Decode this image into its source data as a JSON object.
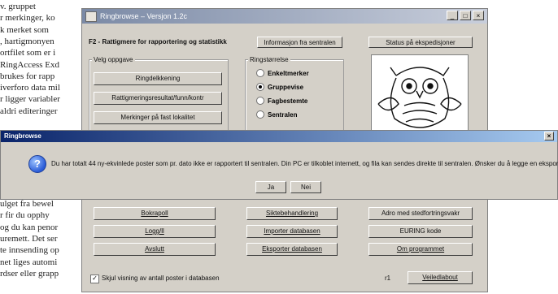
{
  "background_doc": {
    "lines": [
      "v. gruppet",
      "r merkinger, ko",
      "k merket som ",
      ", hartigmonyen",
      "ortfilet som er i",
      "RingAccess Exd",
      "brukes for rapp",
      "iverforo data mil",
      "r ligger variabler",
      "aldri editeringer",
      "",
      "",
      "",
      "",
      "",
      "",
      "",
      "ulget fra bewel",
      "r fir du opphy",
      "og du kan penor",
      "uremett. Det ser",
      "te innsending op",
      "net liges automi",
      "rdser eller grapp"
    ]
  },
  "main_window": {
    "title": "Ringbrowse – Versjon 1.2c",
    "buttons_window": [
      "_",
      "□",
      "×"
    ],
    "heading": "F2 - Rattigmere for rapportering og statistikk",
    "top_buttons": {
      "center": "Informasjon fra sentralen",
      "right": "Status på ekspedisjoner"
    },
    "left_group": {
      "label": "Velg oppgave",
      "buttons": [
        "Ringdelkkening",
        "Rattigmeringsresultat/funn/kontr",
        "Merkinger på fast lokalitet"
      ]
    },
    "mid_group": {
      "label": "Ringstørrelse",
      "radios": [
        {
          "label": "Enkeltmerker",
          "selected": false
        },
        {
          "label": "Gruppevise",
          "selected": true
        },
        {
          "label": "Fagbestemte",
          "selected": false
        },
        {
          "label": "Sentralen",
          "selected": false
        }
      ]
    },
    "bottom_buttons": {
      "col1": [
        "Bokrapoll",
        "Logg/ll",
        "Avslutt"
      ],
      "col2": [
        "Siktebehandlering",
        "Importer databasen",
        "Eksporter databasen"
      ],
      "col3": [
        "Adro med stedfortringsvakr",
        "EURING kode",
        "Om programmet"
      ]
    },
    "footer_checkbox_label": "Skjul visning av antall poster i databasen",
    "footer_checkbox_checked": true,
    "footer_small": "r1",
    "footer_button": "Veiledlabout"
  },
  "dialog": {
    "title": "Ringbrowse",
    "message": "Du har totalt 44 ny-ekvinlede poster som pr. dato ikke er rapportert til sentralen. Din PC er tilkoblet internett, og fila kan sendes direkte til sentralen. Ønsker du å legge en eksportfil til?",
    "buttons": [
      "Ja",
      "Nei"
    ]
  }
}
